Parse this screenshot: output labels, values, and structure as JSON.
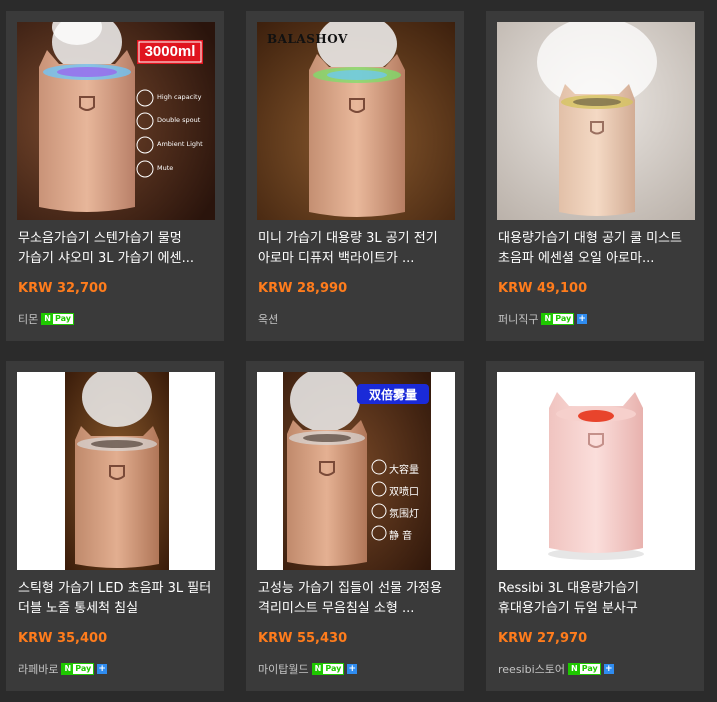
{
  "products": [
    {
      "title": "무소음가습기 스텐가습기 물멍 가습기 샤오미 3L 가습기 에센...",
      "price": "KRW 32,700",
      "seller": "티몬",
      "npay": "Pay",
      "npay_plus": false,
      "image": {
        "badge": "3000ml",
        "features": [
          "High capacity",
          "Double spout",
          "Ambient Light",
          "Mute"
        ]
      }
    },
    {
      "title": "미니 가습기 대용량 3L 공기 전기 아로마 디퓨저 백라이트가 ...",
      "price": "KRW 28,990",
      "seller": "옥션",
      "npay": "",
      "npay_plus": false,
      "image": {
        "brand": "BALASHOV"
      }
    },
    {
      "title": "대용량가습기 대형 공기 쿨 미스트 초음파 에센셜 오일 아로마...",
      "price": "KRW 49,100",
      "seller": "퍼니직구",
      "npay": "Pay",
      "npay_plus": true,
      "image": {}
    },
    {
      "title": "스틱형 가습기 LED 초음파 3L 필터 더블 노즐 통세척 침실",
      "price": "KRW 35,400",
      "seller": "라페바로",
      "npay": "Pay",
      "npay_plus": true,
      "image": {}
    },
    {
      "title": "고성능 가습기 집들이 선물 가정용 격리미스트 무음침실 소형 ...",
      "price": "KRW 55,430",
      "seller": "마이탑월드",
      "npay": "Pay",
      "npay_plus": true,
      "image": {
        "badge": "双倍雾量",
        "features": [
          "大容量",
          "双喷口",
          "氛围灯",
          "静 音"
        ]
      }
    },
    {
      "title": "Ressibi 3L 대용량가습기 휴대용가습기 듀얼 분사구",
      "price": "KRW 27,970",
      "seller": "reesibi스토어",
      "npay": "Pay",
      "npay_plus": true,
      "image": {}
    }
  ],
  "colors": {
    "page_bg": "#2b2b2b",
    "card_bg": "#3a3a3a",
    "price": "#ff7c1c",
    "npay_green": "#1ec800",
    "plus_blue": "#2f8cf0"
  }
}
